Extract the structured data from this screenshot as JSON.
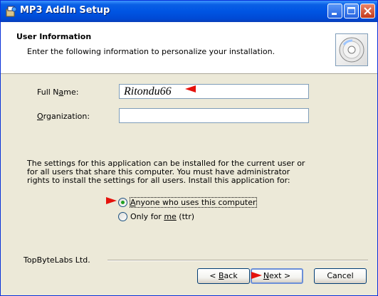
{
  "window": {
    "title": "MP3 AddIn Setup",
    "controls": {
      "minimize": "minimize-icon",
      "maximize": "maximize-icon",
      "close": "close-icon"
    }
  },
  "header": {
    "title": "User Information",
    "subtitle": "Enter the following information to personalize your installation.",
    "icon": "cd-disc-icon"
  },
  "form": {
    "full_name": {
      "label_pre": "Full N",
      "label_key": "a",
      "label_post": "me:",
      "value": "Ritondu66"
    },
    "organization": {
      "label_pre": "",
      "label_key": "O",
      "label_post": "rganization:",
      "value": ""
    }
  },
  "install_for": {
    "description_lines": [
      "The settings for this application can be installed for the current user or",
      "for all users that share this computer. You must have administrator",
      "rights to install the settings for all users. Install this application for:"
    ],
    "options": [
      {
        "pre": "",
        "key": "A",
        "post": "nyone who uses this computer",
        "selected": true
      },
      {
        "pre": "Only for ",
        "key": "me",
        "post": " (ttr)",
        "selected": false
      }
    ]
  },
  "footer": {
    "company": "TopByteLabs Ltd.",
    "back": {
      "pre": "< ",
      "key": "B",
      "post": "ack"
    },
    "next": {
      "pre": "",
      "key": "N",
      "post": "ext >"
    },
    "cancel": "Cancel"
  },
  "colors": {
    "titlebar": "#0055e3",
    "dialog_bg": "#ece9d8",
    "annotation_arrow": "#e5120c",
    "radio_dot": "#21a121"
  }
}
